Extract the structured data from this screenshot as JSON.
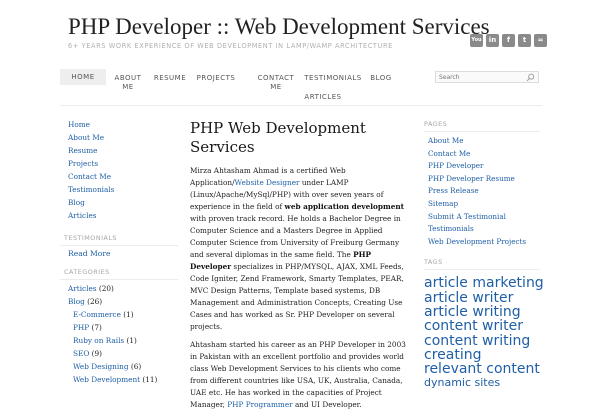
{
  "header": {
    "title": "PHP Developer :: Web Development Services",
    "description": "6+ Years work experience of Web Development in LAMP/WAMP Architecture",
    "social": [
      {
        "label": "You",
        "icon": "youtube-icon"
      },
      {
        "label": "in",
        "icon": "linkedin-icon"
      },
      {
        "label": "f",
        "icon": "facebook-icon"
      },
      {
        "label": "t",
        "icon": "twitter-icon"
      },
      {
        "label": "≈",
        "icon": "rss-icon"
      }
    ]
  },
  "nav": {
    "items": [
      "HOME",
      "ABOUT ME",
      "RESUME",
      "PROJECTS",
      "CONTACT ME",
      "TESTIMONIALS",
      "BLOG",
      "ARTICLES"
    ],
    "search_placeholder": "Search"
  },
  "left": {
    "links": [
      "Home",
      "About Me",
      "Resume",
      "Projects",
      "Contact Me",
      "Testimonials",
      "Blog",
      "Articles"
    ],
    "testimonials_title": "Testimonials",
    "read_more": "Read More",
    "categories_title": "Categories",
    "categories": [
      {
        "name": "Articles",
        "count": "(20)",
        "sub": false
      },
      {
        "name": "Blog",
        "count": "(26)",
        "sub": false
      },
      {
        "name": "E-Commerce",
        "count": "(1)",
        "sub": true
      },
      {
        "name": "PHP",
        "count": "(7)",
        "sub": true
      },
      {
        "name": "Ruby on Rails",
        "count": "(1)",
        "sub": true
      },
      {
        "name": "SEO",
        "count": "(9)",
        "sub": true
      },
      {
        "name": "Web Designing",
        "count": "(6)",
        "sub": true
      },
      {
        "name": "Web Development",
        "count": "(11)",
        "sub": true
      }
    ]
  },
  "main": {
    "title": "PHP Web Development Services",
    "p1": {
      "a": "Mirza Ahtasham Ahmad is a certified Web Application/",
      "link1": "Website Designer",
      "b": " under LAMP (Linux/Apache/MySql/PHP) with over seven years of experience in the field of ",
      "bold1": "web application development",
      "c": " with proven track record. He holds a Bachelor Degree in Computer Science and a Masters Degree in Applied Computer Science from University of Freiburg Germany and several diplomas in the same field. The ",
      "bold2": "PHP Developer",
      "d": " specializes in PHP/MYSQL, AJAX, XML Feeds, Code Igniter, Zend Framework, Smarty Templates, PEAR, MVC Design Patterns, Template based systems, DB Management and Administration Concepts, Creating Use Cases and has worked as Sr. PHP Developer on several projects."
    },
    "p2": {
      "a": "Ahtasham started his career as an PHP Developer in 2003 in Pakistan with an excellent portfolio and provides world class Web Development Services to his clients who come from different countries like USA, UK, Australia, Canada, UAE etc. He has worked in the capacities of Project Manager, ",
      "link1": "PHP Programmer",
      "b": " and UI Developer."
    }
  },
  "right": {
    "pages_title": "Pages",
    "pages": [
      "About Me",
      "Contact Me",
      "PHP Developer",
      "PHP Developer Resume",
      "Press Release",
      "Sitemap",
      "Submit A Testimonial",
      "Testimonials",
      "Web Development Projects"
    ],
    "tags_title": "Tags",
    "tags": [
      "article marketing",
      "article writer",
      "article writing",
      "content writer",
      "content writing",
      "creating relevant content",
      "dynamic sites"
    ]
  }
}
